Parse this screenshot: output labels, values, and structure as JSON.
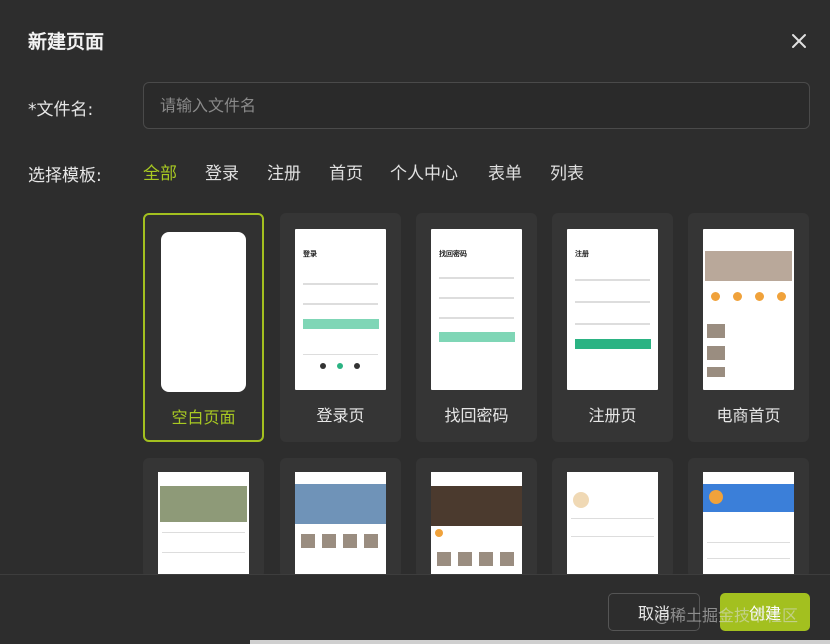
{
  "dialog": {
    "title": "新建页面",
    "file_label": "*文件名:",
    "file_placeholder": "请输入文件名",
    "file_value": "",
    "template_label": "选择模板:"
  },
  "tabs": [
    {
      "label": "全部",
      "active": true
    },
    {
      "label": "登录",
      "active": false
    },
    {
      "label": "注册",
      "active": false
    },
    {
      "label": "首页",
      "active": false
    },
    {
      "label": "个人中心",
      "active": false
    },
    {
      "label": "表单",
      "active": false
    },
    {
      "label": "列表",
      "active": false
    }
  ],
  "templates": [
    {
      "name": "空白页面",
      "selected": true
    },
    {
      "name": "登录页",
      "selected": false
    },
    {
      "name": "找回密码",
      "selected": false
    },
    {
      "name": "注册页",
      "selected": false
    },
    {
      "name": "电商首页",
      "selected": false
    }
  ],
  "thumbs": {
    "login_title": "登录",
    "forgot_title": "找回密码",
    "register_title": "注册"
  },
  "footer": {
    "cancel_label": "取消",
    "create_label": "创建",
    "watermark": "@稀土掘金技术社区"
  },
  "icons": {
    "close": "close-icon"
  },
  "colors": {
    "accent": "#a3c01f",
    "background": "#2d2d2d"
  }
}
